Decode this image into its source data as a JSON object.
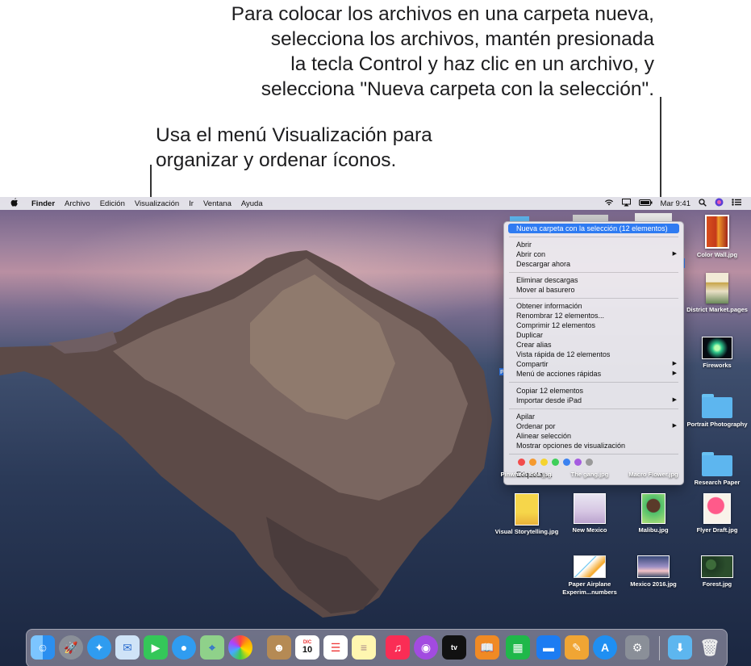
{
  "callouts": {
    "top": [
      "Para colocar los archivos en una carpeta nueva,",
      "selecciona los archivos, mantén presionada",
      "la tecla Control y haz clic en un archivo, y",
      "selecciona \"Nueva carpeta con la selección\"."
    ],
    "left": [
      "Usa el menú Visualización para",
      "organizar y ordenar íconos."
    ]
  },
  "menubar": {
    "apple": "",
    "items": [
      "Finder",
      "Archivo",
      "Edición",
      "Visualización",
      "Ir",
      "Ventana",
      "Ayuda"
    ],
    "clock": "Mar 9:41",
    "status_icons": [
      "wifi-icon",
      "airplay-icon",
      "battery-icon",
      "search-icon",
      "siri-icon",
      "control-center-icon"
    ]
  },
  "context_menu": {
    "highlighted": "Nueva carpeta con la selección (12 elementos)",
    "group1": [
      "Abrir",
      "Abrir con",
      "Descargar ahora"
    ],
    "group2": [
      "Eliminar descargas",
      "Mover al basurero"
    ],
    "group3": [
      "Obtener información",
      "Renombrar 12 elementos...",
      "Comprimir 12 elementos",
      "Duplicar",
      "Crear alias",
      "Vista rápida de 12 elementos",
      "Compartir",
      "Menú de acciones rápidas"
    ],
    "group4": [
      "Copiar 12 elementos",
      "Importar desde iPad"
    ],
    "group5": [
      "Apilar",
      "Ordenar por",
      "Alinear selección",
      "Mostrar opciones de visualización"
    ],
    "tag_colors": [
      "#f24c4c",
      "#f59a2f",
      "#f5d32f",
      "#3fcf5a",
      "#3b82f0",
      "#a65ce0",
      "#9a9a9a"
    ],
    "tags_label": "Etiquetas...",
    "submenu_arrow": "▶"
  },
  "desktop_icons": {
    "color_wall": "Color Wall.jpg",
    "district": "District Market.pages",
    "fireworks": "Fireworks",
    "portrait": "Portrait Photography",
    "research": "Research Paper",
    "pinwheel": "Pinwheel Idea.jpg",
    "gang": "The gang.jpg",
    "macro": "Macro Flower.jpg",
    "visual": "Visual Storytelling.jpg",
    "newmexico": "New Mexico",
    "malibu": "Malibu.jpg",
    "flyer": "Flyer Draft.jpg",
    "paper_line1": "Paper Airplane",
    "paper_line2": "Experim...numbers",
    "mexico2016": "Mexico 2016.jpg",
    "forest": "Forest.jpg",
    "partial_label": "P"
  },
  "dock": {
    "apps": [
      "Finder",
      "Launchpad",
      "Safari",
      "Mail",
      "FaceTime",
      "Mensajes",
      "Mapas",
      "Fotos",
      "Contactos",
      "Calendario",
      "Recordatorios",
      "Notas",
      "Música",
      "Podcasts",
      "TV",
      "Libros",
      "Numbers",
      "Keynote",
      "Pages",
      "App Store",
      "Preferencias del Sistema",
      "Descargas",
      "Basurero"
    ],
    "calendar_month": "DIC",
    "calendar_day": "10",
    "tv_label": "tv"
  }
}
